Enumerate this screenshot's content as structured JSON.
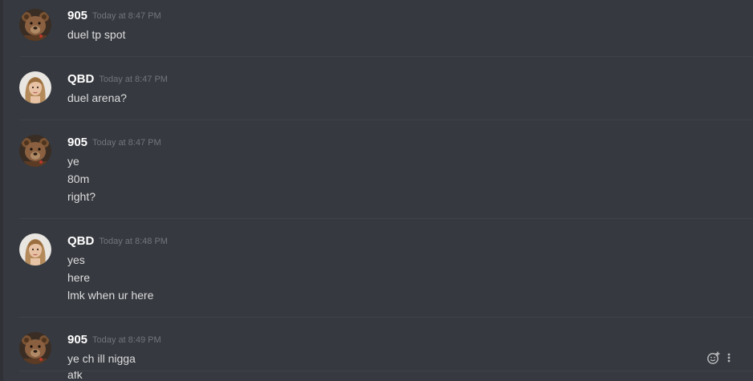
{
  "messages": [
    {
      "author": "905",
      "timestamp": "Today at 8:47 PM",
      "avatar": "teddy-bear-avatar",
      "lines": [
        "duel tp spot"
      ]
    },
    {
      "author": "QBD",
      "timestamp": "Today at 8:47 PM",
      "avatar": "woman-portrait-avatar",
      "lines": [
        "duel arena?"
      ]
    },
    {
      "author": "905",
      "timestamp": "Today at 8:47 PM",
      "avatar": "teddy-bear-avatar",
      "lines": [
        "ye",
        "80m",
        "right?"
      ]
    },
    {
      "author": "QBD",
      "timestamp": "Today at 8:48 PM",
      "avatar": "woman-portrait-avatar",
      "lines": [
        "yes",
        "here",
        "lmk when ur here"
      ]
    },
    {
      "author": "905",
      "timestamp": "Today at 8:49 PM",
      "avatar": "teddy-bear-avatar",
      "lines": [
        "ye ch ill nigga",
        "afk"
      ]
    }
  ],
  "actions": {
    "add_reaction_icon": "add-reaction-icon",
    "more_icon": "more-options-icon"
  },
  "colors": {
    "background": "#36393f",
    "username": "#ffffff",
    "text": "#dcddde",
    "timestamp": "#72767d",
    "divider": "#3f4248"
  }
}
